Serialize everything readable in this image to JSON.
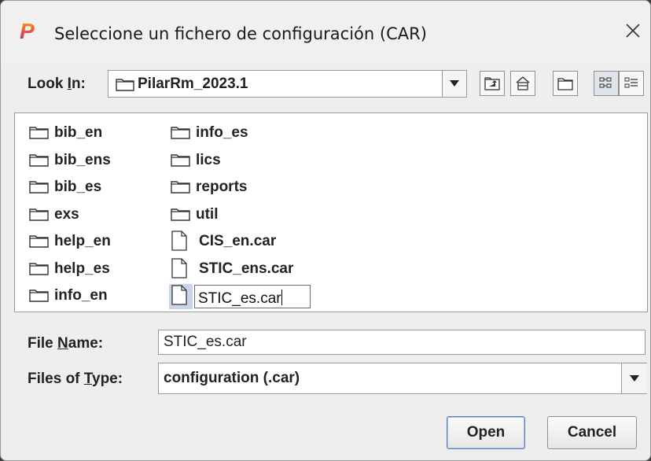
{
  "window": {
    "title": "Seleccione un fichero de configuración (CAR)",
    "app_icon": "p-logo-icon",
    "close_icon": "close-icon"
  },
  "look_in": {
    "label_pre": "Look ",
    "label_ul": "I",
    "label_post": "n:",
    "value": "PilarRm_2023.1"
  },
  "toolbar": {
    "buttons": [
      "up-folder-icon",
      "home-icon",
      "new-folder-icon",
      "list-view-icon",
      "details-view-icon"
    ]
  },
  "files": {
    "col1": [
      {
        "name": "bib_en",
        "type": "folder"
      },
      {
        "name": "bib_ens",
        "type": "folder"
      },
      {
        "name": "bib_es",
        "type": "folder"
      },
      {
        "name": "exs",
        "type": "folder"
      },
      {
        "name": "help_en",
        "type": "folder"
      },
      {
        "name": "help_es",
        "type": "folder"
      },
      {
        "name": "info_en",
        "type": "folder"
      }
    ],
    "col2": [
      {
        "name": "info_es",
        "type": "folder"
      },
      {
        "name": "lics",
        "type": "folder"
      },
      {
        "name": "reports",
        "type": "folder"
      },
      {
        "name": "util",
        "type": "folder"
      },
      {
        "name": "CIS_en.car",
        "type": "file"
      },
      {
        "name": "STIC_ens.car",
        "type": "file"
      },
      {
        "name": "STIC_es.car",
        "type": "file",
        "selected": true,
        "editing": true
      }
    ]
  },
  "file_name": {
    "label_pre": "File ",
    "label_ul": "N",
    "label_post": "ame:",
    "value": "STIC_es.car"
  },
  "files_of_type": {
    "label_pre": "Files of ",
    "label_ul": "T",
    "label_post": "ype:",
    "value": "configuration (.car)"
  },
  "buttons": {
    "open": "Open",
    "cancel": "Cancel"
  },
  "colors": {
    "accent_p_top": "#f0a020",
    "accent_p_bottom": "#c02a8a",
    "selection": "#c9d6e8"
  }
}
